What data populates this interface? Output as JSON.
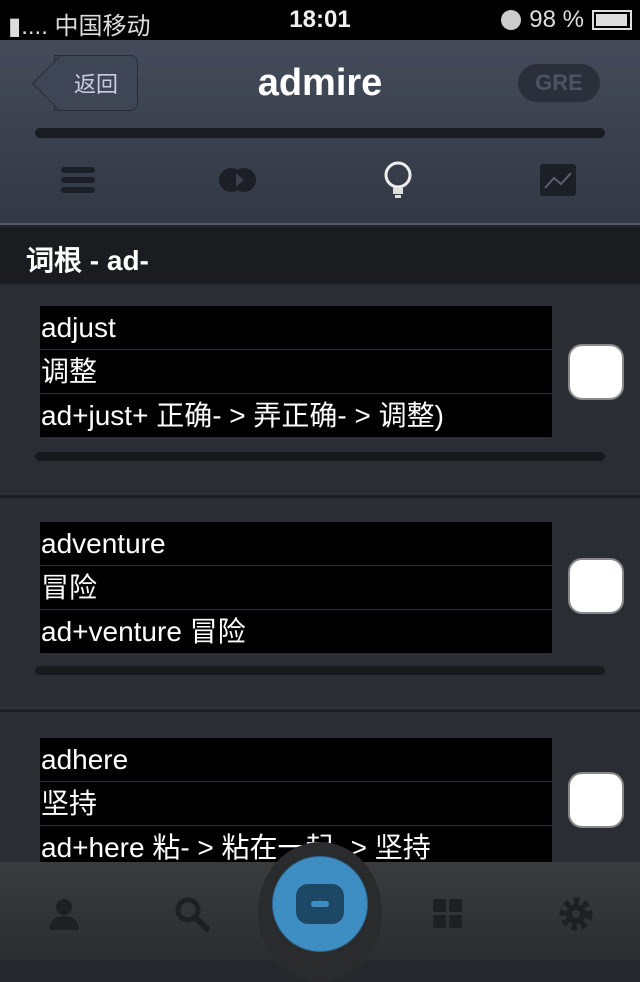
{
  "status": {
    "carrier": "▮.... 中国移动",
    "time": "18:01",
    "battery": "98 %",
    "battery_level": 0.98
  },
  "header": {
    "back_label": "返回",
    "title": "admire",
    "badge": "GRE",
    "progress": 0
  },
  "nav_tabs": [
    {
      "icon": "list-icon"
    },
    {
      "icon": "venn-icon"
    },
    {
      "icon": "lightbulb-icon",
      "active": true
    },
    {
      "icon": "chart-icon"
    }
  ],
  "section": {
    "title": "词根 - ad-"
  },
  "words": [
    {
      "word": "adjust",
      "meaning": "调整",
      "etymology": "ad+just+ 正确- > 弄正确- > 调整)"
    },
    {
      "word": "adventure",
      "meaning": "冒险",
      "etymology": "ad+venture 冒险"
    },
    {
      "word": "adhere",
      "meaning": "坚持",
      "etymology": "ad+here 粘- > 粘在一起- > 坚持"
    }
  ],
  "tabbar": [
    {
      "icon": "user-icon"
    },
    {
      "icon": "search-icon"
    },
    {
      "icon": "home-icon"
    },
    {
      "icon": "grid-icon"
    },
    {
      "icon": "gear-icon"
    }
  ]
}
